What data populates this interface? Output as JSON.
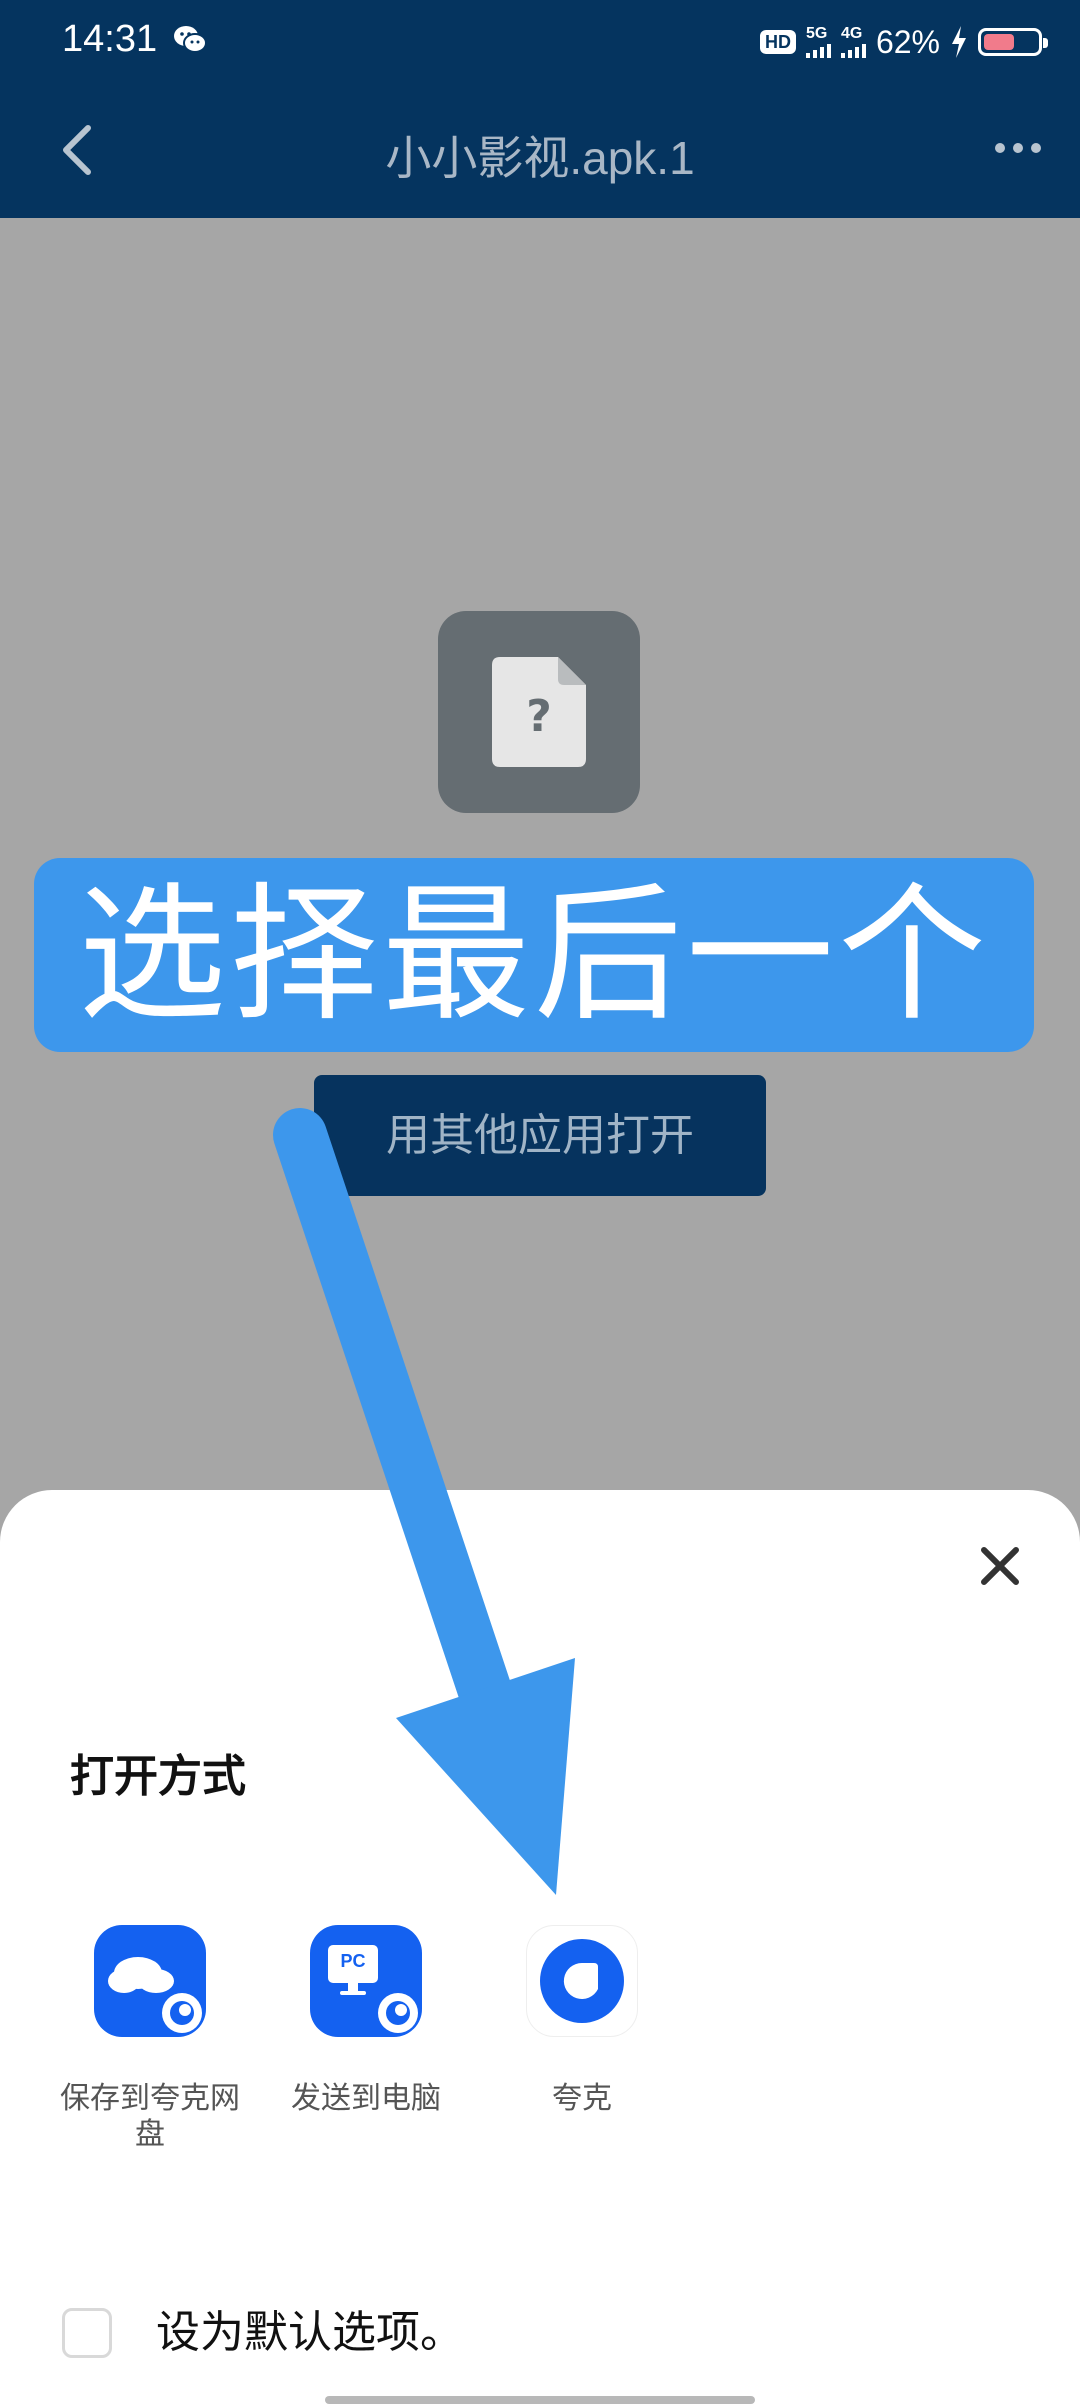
{
  "status_bar": {
    "time": "14:31",
    "hd_tag": "HD",
    "sim1": "5G",
    "sim2": "4G",
    "battery_text": "62%",
    "battery_level": 0.62
  },
  "header": {
    "title": "小小影视.apk.1"
  },
  "content": {
    "overlay_banner": "选择最后一个",
    "open_other_button": "用其他应用打开"
  },
  "sheet": {
    "title": "打开方式",
    "apps": [
      {
        "label": "保存到夸克网盘",
        "icon": "quark-cloud-icon",
        "badge_text": ""
      },
      {
        "label": "发送到电脑",
        "icon": "quark-pc-icon",
        "badge_text": "PC"
      },
      {
        "label": "夸克",
        "icon": "quark-icon",
        "badge_text": ""
      }
    ],
    "default_label": "设为默认选项。"
  },
  "colors": {
    "header_bg": "#05345f",
    "banner_bg": "#3d97ec",
    "app_blue": "#1461f0"
  }
}
